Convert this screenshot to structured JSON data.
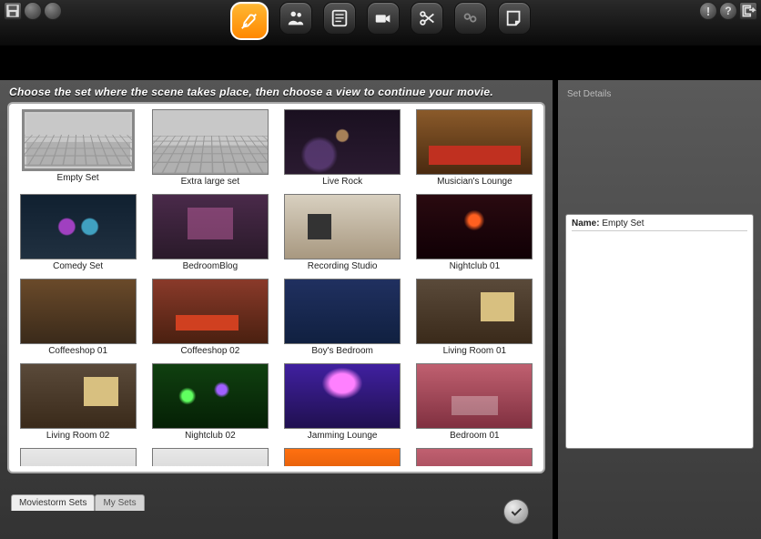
{
  "instruction": "Choose the set where the scene takes place, then choose a view to continue your movie.",
  "details_panel": {
    "title": "Set Details",
    "name_label": "Name:",
    "name_value": "Empty Set"
  },
  "tabs": [
    {
      "label": "Moviestorm Sets",
      "active": true
    },
    {
      "label": "My Sets",
      "active": false
    }
  ],
  "selected_set_index": 0,
  "sets": [
    {
      "label": "Empty Set",
      "thumb": "th-grid"
    },
    {
      "label": "Extra large set",
      "thumb": "th-grid"
    },
    {
      "label": "Live Rock",
      "thumb": "th-stage"
    },
    {
      "label": "Musician's Lounge",
      "thumb": "th-lounge"
    },
    {
      "label": "Comedy Set",
      "thumb": "th-comedy"
    },
    {
      "label": "BedroomBlog",
      "thumb": "th-bedroom"
    },
    {
      "label": "Recording Studio",
      "thumb": "th-studio"
    },
    {
      "label": "Nightclub 01",
      "thumb": "th-club"
    },
    {
      "label": "Coffeeshop 01",
      "thumb": "th-coffee"
    },
    {
      "label": "Coffeeshop 02",
      "thumb": "th-coffee2"
    },
    {
      "label": "Boy's Bedroom",
      "thumb": "th-boys"
    },
    {
      "label": "Living Room 01",
      "thumb": "th-living"
    },
    {
      "label": "Living Room 02",
      "thumb": "th-living"
    },
    {
      "label": "Nightclub 02",
      "thumb": "th-club2"
    },
    {
      "label": "Jamming Lounge",
      "thumb": "th-jam"
    },
    {
      "label": "Bedroom 01",
      "thumb": "th-pink"
    },
    {
      "label": "",
      "thumb": "th-white"
    },
    {
      "label": "",
      "thumb": "th-white"
    },
    {
      "label": "",
      "thumb": "th-orange"
    },
    {
      "label": "",
      "thumb": "th-pink"
    }
  ],
  "toolbar_icons": [
    "tools",
    "characters",
    "script",
    "camera",
    "cut",
    "effects",
    "notes"
  ],
  "help_icons": [
    "alert",
    "help",
    "exit"
  ]
}
